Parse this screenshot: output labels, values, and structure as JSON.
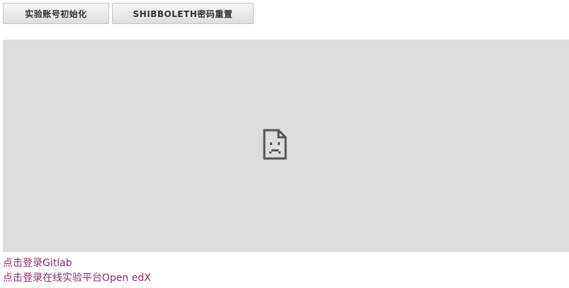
{
  "buttons": {
    "init_account": "实验账号初始化",
    "shibboleth_reset": "SHIBBOLETH密码重置"
  },
  "embed": {
    "icon": "broken-page-icon",
    "background_color": "#dddddd"
  },
  "links": {
    "gitlab": "点击登录Gitlab",
    "openedx": "点击登录在线实验平台Open edX"
  },
  "colors": {
    "link": "#8e2a6c",
    "button_text": "#333333"
  }
}
